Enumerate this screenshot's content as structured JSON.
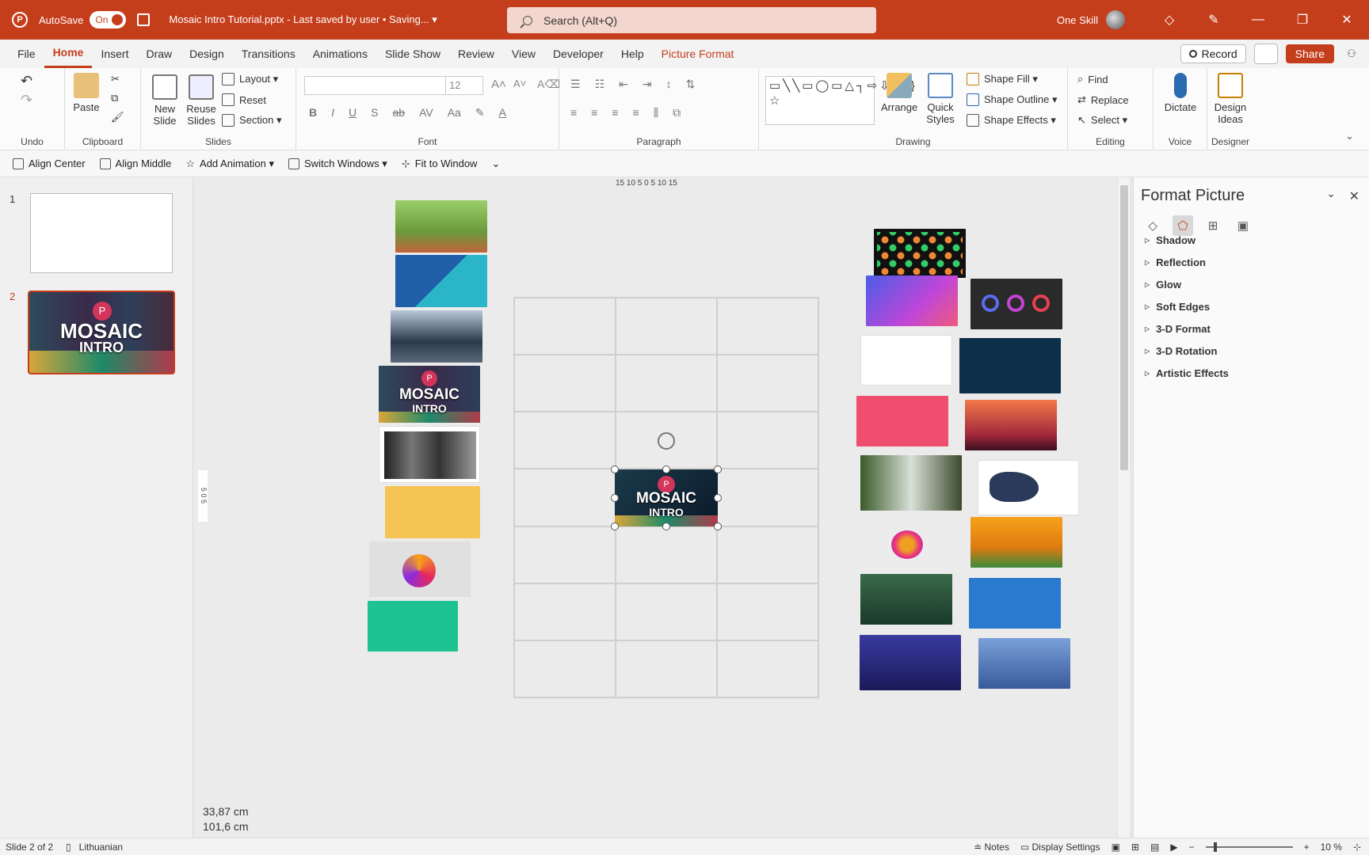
{
  "titlebar": {
    "autosave_label": "AutoSave",
    "autosave_state": "On",
    "doc_title": "Mosaic Intro Tutorial.pptx  -  Last saved by user • Saving... ▾",
    "search_placeholder": "Search (Alt+Q)",
    "user_name": "One Skill",
    "app_glyph": "P",
    "controls": {
      "minimize": "—",
      "maximize": "❐",
      "close": "✕"
    }
  },
  "menu": {
    "tabs": [
      "File",
      "Home",
      "Insert",
      "Draw",
      "Design",
      "Transitions",
      "Animations",
      "Slide Show",
      "Review",
      "View",
      "Developer",
      "Help",
      "Picture Format"
    ],
    "active": "Home",
    "record_label": "Record",
    "share_label": "Share"
  },
  "ribbon": {
    "groups": {
      "undo": "Undo",
      "clipboard": "Clipboard",
      "slides": "Slides",
      "font": "Font",
      "paragraph": "Paragraph",
      "drawing": "Drawing",
      "editing": "Editing",
      "voice": "Voice",
      "designer": "Designer"
    },
    "paste": "Paste",
    "new_slide": "New Slide",
    "reuse_slides": "Reuse Slides",
    "layout": "Layout ▾",
    "reset": "Reset",
    "section": "Section ▾",
    "font_size": "12",
    "font_glyphs": [
      "B",
      "I",
      "U",
      "S",
      "ab",
      "AV",
      "Aa"
    ],
    "arrange": "Arrange",
    "quick_styles": "Quick Styles",
    "shape_fill": "Shape Fill ▾",
    "shape_outline": "Shape Outline ▾",
    "shape_effects": "Shape Effects ▾",
    "find": "Find",
    "replace": "Replace",
    "select": "Select ▾",
    "dictate": "Dictate",
    "design_ideas": "Design Ideas"
  },
  "quick_access": {
    "items": [
      "Align Center",
      "Align Middle",
      "Add Animation ▾",
      "Switch Windows ▾",
      "Fit to Window"
    ]
  },
  "thumbnails": {
    "slides": [
      "1",
      "2"
    ],
    "active_slide": 2,
    "slide2_text1": "MOSAIC",
    "slide2_text2": "INTRO",
    "slide2_badge": "P"
  },
  "canvas": {
    "ruler_top": "15 10 5 0 5 10 15",
    "ruler_left": "5 0 5",
    "center_title1": "MOSAIC",
    "center_title2": "INTRO",
    "center_badge": "P",
    "left_tile_title1": "MOSAIC",
    "left_tile_title2": "INTRO",
    "left_tile_badge": "P",
    "width_readout": "33,87 cm",
    "height_readout": "101,6 cm"
  },
  "panel": {
    "title": "Format Picture",
    "sections": [
      "Shadow",
      "Reflection",
      "Glow",
      "Soft Edges",
      "3-D Format",
      "3-D Rotation",
      "Artistic Effects"
    ]
  },
  "status": {
    "slide_info": "Slide 2 of 2",
    "language": "Lithuanian",
    "notes": "Notes",
    "display_settings": "Display Settings",
    "zoom": "10 %"
  },
  "colors": {
    "accent": "#c43e1c"
  }
}
